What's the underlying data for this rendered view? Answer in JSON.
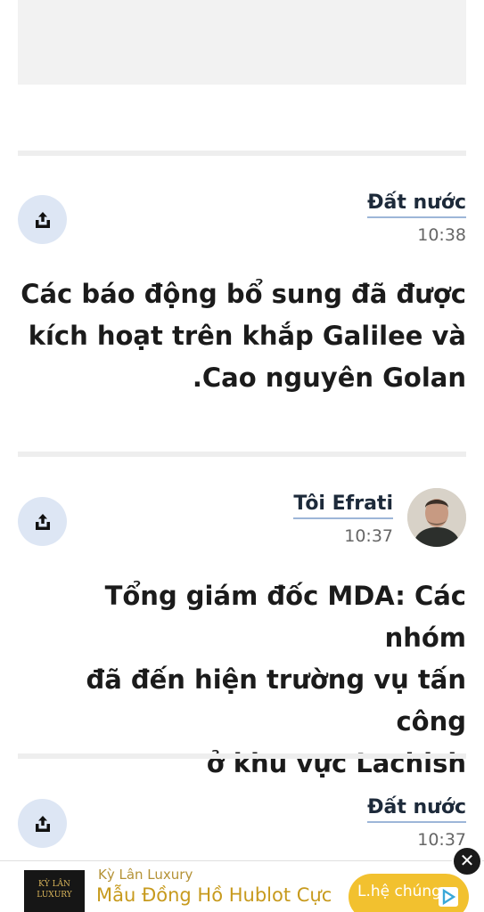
{
  "feed": {
    "items": [
      {
        "author": "Đất nước",
        "time": "10:38",
        "headline_lines": [
          "Các báo động bổ sung đã được",
          "kích hoạt trên khắp Galilee và",
          ".Cao nguyên Golan"
        ]
      },
      {
        "author": "Tôi Efrati",
        "time": "10:37",
        "headline_lines": [
          "Tổng giám đốc MDA: Các nhóm",
          "đã đến hiện trường vụ tấn công",
          "ở khu vực Lachish"
        ]
      },
      {
        "author": "Đất nước",
        "time": "10:37",
        "headline_lines": []
      }
    ]
  },
  "ad": {
    "logo_line1": "KỲ LÂN",
    "logo_line2": "LUXURY",
    "sponsor": "Kỳ Lân Luxury",
    "title": "Mẫu Đồng Hồ Hublot Cực",
    "cta": "L.hệ chúng",
    "close_symbol": "✕"
  },
  "icons": {
    "share": "share-icon",
    "close": "close-icon",
    "ad_choices": "ad-choices-icon"
  },
  "colors": {
    "share_bg": "#dde6f4",
    "author_underline": "#9db6d8",
    "ad_cta": "#f2c12f",
    "ad_text": "#c79a1d"
  }
}
